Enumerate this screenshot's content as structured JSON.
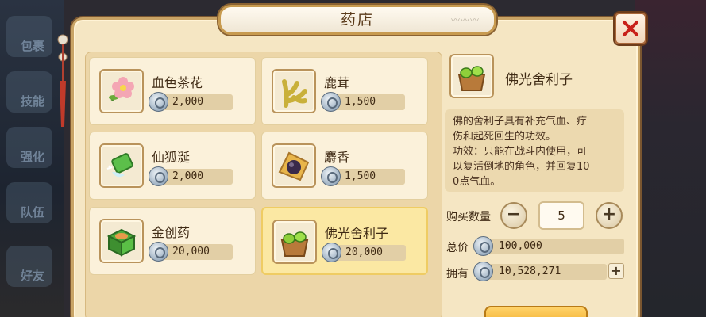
{
  "window": {
    "title": "药店"
  },
  "side_menu": [
    {
      "label": "包裹"
    },
    {
      "label": "技能"
    },
    {
      "label": "强化"
    },
    {
      "label": "队伍"
    },
    {
      "label": "好友"
    }
  ],
  "items": [
    {
      "name": "血色茶花",
      "price": "2,000",
      "icon": "camellia-icon"
    },
    {
      "name": "鹿茸",
      "price": "1,500",
      "icon": "antler-icon"
    },
    {
      "name": "仙狐涎",
      "price": "2,000",
      "icon": "jade-potion-icon"
    },
    {
      "name": "麝香",
      "price": "1,500",
      "icon": "musk-icon"
    },
    {
      "name": "金创药",
      "price": "20,000",
      "icon": "medicine-box-icon"
    },
    {
      "name": "佛光舍利子",
      "price": "20,000",
      "icon": "sarira-icon",
      "selected": true
    }
  ],
  "detail": {
    "name": "佛光舍利子",
    "desc_line1": "佛的舍利子具有补充气血、疗",
    "desc_line2": "伤和起死回生的功效。",
    "desc_line3": "功效：只能在战斗内使用，可",
    "desc_line4": "以复活倒地的角色，并回复10",
    "desc_line5": "0点气血。"
  },
  "purchase": {
    "qty_label": "购买数量",
    "qty_value": "5",
    "total_label": "总价",
    "total_value": "100,000",
    "owned_label": "拥有",
    "owned_value": "10,528,271"
  },
  "colors": {
    "panel": "#f5e6c3",
    "selected": "#fbe8a3",
    "close": "#c8201a"
  }
}
